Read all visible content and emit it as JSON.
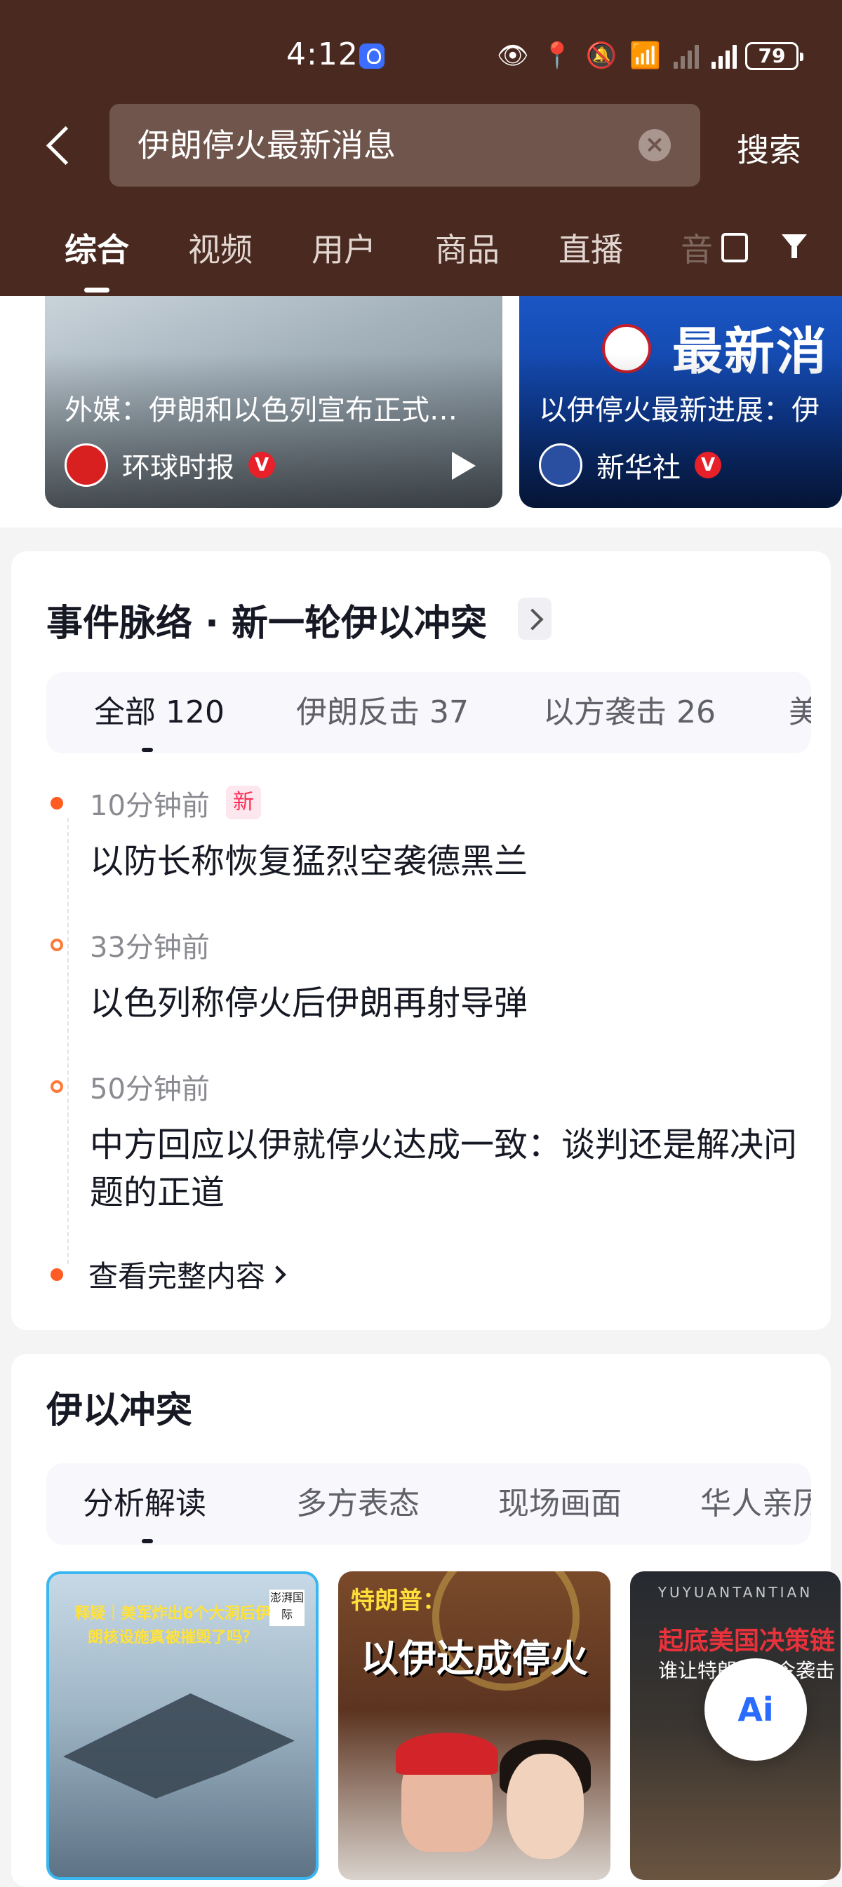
{
  "status": {
    "time": "4:12",
    "battery": "79"
  },
  "search": {
    "query": "伊朗停火最新消息",
    "button": "搜索"
  },
  "tabs": {
    "items": [
      "综合",
      "视频",
      "用户",
      "商品",
      "直播",
      "音"
    ]
  },
  "videos": [
    {
      "title": "外媒：伊朗和以色列宣布正式…",
      "source": "环球时报",
      "verified": "V"
    },
    {
      "title": "以伊停火最新进展：伊",
      "source": "新华社",
      "verified": "V",
      "banner": "最新消"
    }
  ],
  "event": {
    "title": "事件脉络 · 新一轮伊以冲突",
    "tabs": [
      "全部 120",
      "伊朗反击 37",
      "以方袭击 26",
      "美"
    ],
    "items": [
      {
        "time": "10分钟前",
        "badge": "新",
        "text": "以防长称恢复猛烈空袭德黑兰"
      },
      {
        "time": "33分钟前",
        "text": "以色列称停火后伊朗再射导弹"
      },
      {
        "time": "50分钟前",
        "text": "中方回应以伊就停火达成一致：谈判还是解决问题的正道"
      }
    ],
    "more": "查看完整内容"
  },
  "conflict": {
    "title": "伊以冲突",
    "tabs": [
      "分析解读",
      "多方表态",
      "现场画面",
      "华人亲历"
    ],
    "thumbs": [
      {
        "headline": "释疑｜美军炸出6个大洞后伊朗核设施真被摧毁了吗？",
        "tag": "澎湃国际"
      },
      {
        "label": "特朗普：",
        "headline": "以伊达成停火"
      },
      {
        "top": "YUYUANTANTIAN",
        "headline": "起底美国决策链",
        "sub": "谁让特朗普下令袭击"
      }
    ]
  },
  "ai": {
    "label": "Ai"
  }
}
